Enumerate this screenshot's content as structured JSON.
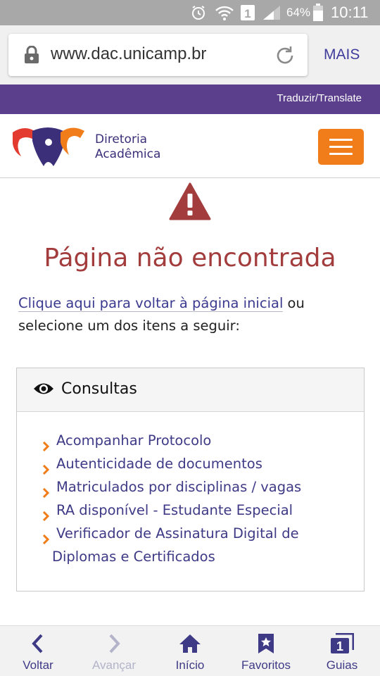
{
  "status_bar": {
    "battery_percent": "64%",
    "time": "10:11",
    "sim_label": "1",
    "icons": [
      "alarm-icon",
      "wifi-icon",
      "sim-icon",
      "signal-icon",
      "battery-icon"
    ]
  },
  "browser": {
    "url": "www.dac.unicamp.br",
    "more_label": "MAIS"
  },
  "top_band": {
    "translate_label": "Traduzir/Translate",
    "color": "#5b3f8c"
  },
  "header": {
    "brand_line1": "Diretoria",
    "brand_line2": "Acadêmica",
    "menu_color": "#f07d1a"
  },
  "content": {
    "title": "Página não encontrada",
    "home_link": "Clique aqui para voltar à página inicial",
    "intro_rest": " ou selecione um dos itens a seguir:"
  },
  "panel": {
    "title": "Consultas",
    "items": [
      "Acompanhar Protocolo",
      "Autenticidade de documentos",
      "Matriculados por disciplinas / vagas",
      "RA disponível - Estudante Especial"
    ],
    "last_item_line1": "Verificador de Assinatura Digital de",
    "last_item_line2": "Diplomas e Certificados"
  },
  "bottom_nav": {
    "back": "Voltar",
    "forward": "Avançar",
    "home": "Início",
    "favorites": "Favoritos",
    "tabs": "Guias",
    "tabs_count": "1"
  }
}
